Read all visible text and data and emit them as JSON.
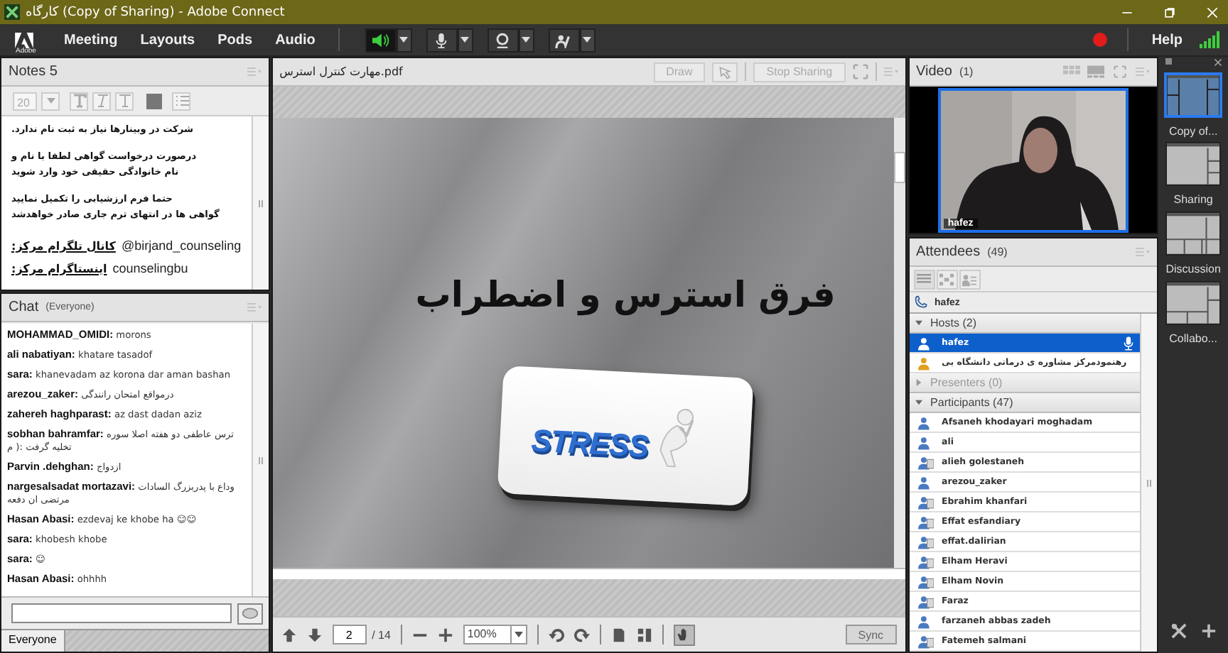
{
  "window": {
    "title": "کارگاه (Copy of Sharing) - Adobe Connect"
  },
  "menubar": {
    "logo_text": "Adobe",
    "menus": [
      "Meeting",
      "Layouts",
      "Pods",
      "Audio"
    ],
    "audio_controls": [
      {
        "kind": "speaker",
        "on": true
      },
      {
        "kind": "mic",
        "on": false
      },
      {
        "kind": "camera",
        "on": false
      },
      {
        "kind": "hand",
        "on": false
      }
    ],
    "recording": true,
    "help": "Help"
  },
  "notes": {
    "title": "Notes 5",
    "font_size": "20",
    "paragraphs": [
      {
        "lines": [
          "شرکت در وبینارها نیاز به ثبت نام ندارد."
        ]
      },
      {
        "lines": [
          "درصورت درخواست گواهی لطفا با نام و",
          "نام خانوادگی حقیقی خود وارد شوید"
        ]
      },
      {
        "lines": [
          "حتما فرم ارزشیابی را تکمیل نمایید",
          "گواهی ها در انتهای ترم جاری صادر خواهدشد"
        ]
      }
    ],
    "contacts": [
      {
        "label": "کانال تلگرام مرکز:",
        "value": "@birjand_counseling"
      },
      {
        "label": "اینستاگرام مرکز:",
        "value": "counselingbu"
      }
    ]
  },
  "chat": {
    "title": "Chat",
    "scope": "(Everyone)",
    "messages": [
      {
        "sender": "MOHAMMAD_OMIDI:",
        "text": "morons"
      },
      {
        "sender": "ali nabatiyan:",
        "text": "khatare tasadof"
      },
      {
        "sender": "sara:",
        "text": "khanevadam az korona dar aman bashan"
      },
      {
        "sender": "arezou_zaker:",
        "text": "درمواقع امتحان رانندگی"
      },
      {
        "sender": "zahereh haghparast:",
        "text": "az dast dadan aziz"
      },
      {
        "sender": "sobhan bahramfar:",
        "text": "ترس عاطفی دو هفته اصلا سوره تخلیه گرفت :( م"
      },
      {
        "sender": "Parvin .dehghan:",
        "text": "ازدواج"
      },
      {
        "sender": "nargesalsadat mortazavi:",
        "text": "وداع با پدربزرگ السادات مرتضی ان دفعه"
      },
      {
        "sender": "Hasan Abasi:",
        "text": "ezdevaj ke khobe ha ☺☺"
      },
      {
        "sender": "sara:",
        "text": "khobesh khobe"
      },
      {
        "sender": "sara:",
        "text": "☺"
      },
      {
        "sender": "Hasan Abasi:",
        "text": "ohhhh"
      }
    ],
    "tab": "Everyone"
  },
  "share": {
    "title": "مهارت کنترل استرس.pdf",
    "buttons": [
      "Draw",
      "Stop Sharing"
    ],
    "slide": {
      "title": "فرق استرس و اضطراب",
      "art_text": "STRESS"
    },
    "page": "2",
    "page_total": "/ 14",
    "zoom": "100%",
    "hand_tool_selected": true,
    "sync": "Sync"
  },
  "video": {
    "title": "Video",
    "count": "(1)",
    "feeds": [
      {
        "name": "hafez",
        "kind": "picture"
      }
    ]
  },
  "attendees": {
    "title": "Attendees",
    "count": "(49)",
    "me": "hafez",
    "groups": [
      {
        "label": "Hosts (2)",
        "expanded": true,
        "members": [
          {
            "name": "hafez",
            "kind": "host",
            "selected": true,
            "mic": true
          },
          {
            "name": "رهنمودمرکز مشاوره ی درمانی دانشگاه بی",
            "kind": "host",
            "selected": false,
            "mic": false
          }
        ]
      },
      {
        "label": "Presenters (0)",
        "expanded": false
      },
      {
        "label": "Participants (47)",
        "expanded": true,
        "members": [
          {
            "name": "Afsaneh khodayari moghadam",
            "kind": "user",
            "selected": false,
            "mic": false
          },
          {
            "name": "ali",
            "kind": "user",
            "selected": false,
            "mic": false
          },
          {
            "name": "alieh golestaneh",
            "kind": "guest",
            "selected": false,
            "mic": false
          },
          {
            "name": "arezou_zaker",
            "kind": "user",
            "selected": false,
            "mic": false
          },
          {
            "name": "Ebrahim khanfari",
            "kind": "guest",
            "selected": false,
            "mic": false
          },
          {
            "name": "Effat esfandiary",
            "kind": "guest",
            "selected": false,
            "mic": false
          },
          {
            "name": "effat.dalirian",
            "kind": "guest",
            "selected": false,
            "mic": false
          },
          {
            "name": "Elham Heravi",
            "kind": "guest",
            "selected": false,
            "mic": false
          },
          {
            "name": "Elham Novin",
            "kind": "guest",
            "selected": false,
            "mic": false
          },
          {
            "name": "Faraz",
            "kind": "guest",
            "selected": false,
            "mic": false
          },
          {
            "name": "farzaneh abbas zadeh",
            "kind": "user",
            "selected": false,
            "mic": false
          },
          {
            "name": "Fatemeh salmani",
            "kind": "guest",
            "selected": false,
            "mic": false
          }
        ]
      }
    ]
  },
  "layouts": [
    {
      "label": "Copy of...",
      "kind": "main",
      "selected": true
    },
    {
      "label": "Sharing",
      "kind": "sharing",
      "selected": false
    },
    {
      "label": "Discussion",
      "kind": "discussion",
      "selected": false
    },
    {
      "label": "Collabo...",
      "kind": "collab",
      "selected": false
    }
  ]
}
